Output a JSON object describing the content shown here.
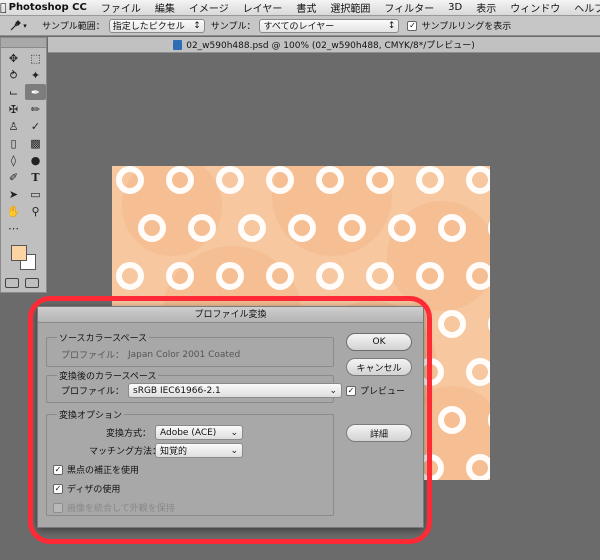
{
  "menubar": {
    "app_name": "Photoshop CC",
    "items": [
      "ファイル",
      "編集",
      "イメージ",
      "レイヤー",
      "書式",
      "選択範囲",
      "フィルター",
      "3D",
      "表示",
      "ウィンドウ",
      "ヘルプ"
    ]
  },
  "options_bar": {
    "sample_size_label": "サンプル範囲：",
    "sample_size_value": "指定したピクセル",
    "sample_label": "サンプル：",
    "sample_value": "すべてのレイヤー",
    "show_ring_label": "サンプルリングを表示",
    "show_ring_checked": true
  },
  "document": {
    "tab_title": "02_w590h488.psd @ 100% (02_w590h488, CMYK/8*/プレビュー)"
  },
  "colors": {
    "foreground": "#fcd4a4",
    "background": "#ffffff",
    "highlight": "#ff2a35"
  },
  "dialog": {
    "title": "プロファイル変換",
    "source_group": {
      "title": "ソースカラースペース",
      "profile_label": "プロファイル：",
      "profile_value": "Japan Color 2001 Coated"
    },
    "dest_group": {
      "title": "変換後のカラースペース",
      "profile_label": "プロファイル：",
      "profile_value": "sRGB IEC61966-2.1"
    },
    "options_group": {
      "title": "変換オプション",
      "engine_label": "変換方式：",
      "engine_value": "Adobe (ACE)",
      "intent_label": "マッチング方法：",
      "intent_value": "知覚的",
      "bpc_label": "黒点の補正を使用",
      "bpc_checked": true,
      "dither_label": "ディザの使用",
      "dither_checked": true,
      "flatten_label": "画像を統合して外観を保持",
      "flatten_checked": false
    },
    "ok_label": "OK",
    "cancel_label": "キャンセル",
    "preview_label": "プレビュー",
    "preview_checked": true,
    "advanced_label": "詳細"
  }
}
